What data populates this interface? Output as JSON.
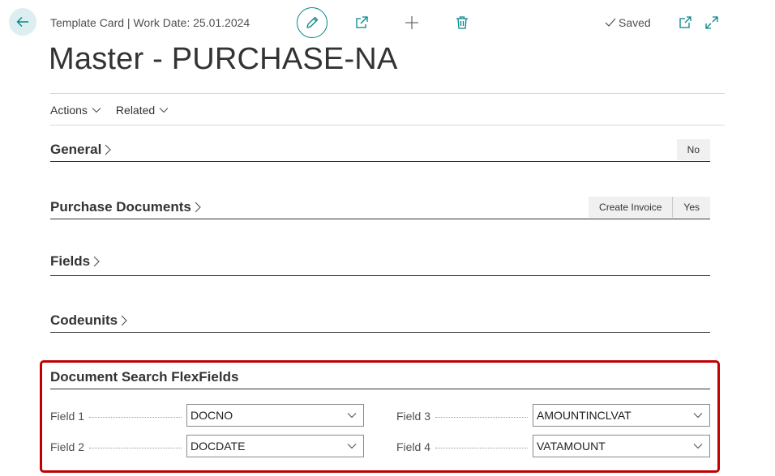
{
  "header": {
    "caption": "Template Card | Work Date: 25.01.2024",
    "saved_label": "Saved"
  },
  "page": {
    "title": "Master - PURCHASE-NA"
  },
  "actions": {
    "actions_label": "Actions",
    "related_label": "Related"
  },
  "sections": {
    "general": {
      "title": "General",
      "pill": "No"
    },
    "purchase_documents": {
      "title": "Purchase Documents",
      "pill_create": "Create Invoice",
      "pill_yes": "Yes"
    },
    "fields": {
      "title": "Fields"
    },
    "codeunits": {
      "title": "Codeunits"
    }
  },
  "flexfields": {
    "title": "Document Search FlexFields",
    "field1": {
      "label": "Field 1",
      "value": "DOCNO"
    },
    "field2": {
      "label": "Field 2",
      "value": "DOCDATE"
    },
    "field3": {
      "label": "Field 3",
      "value": "AMOUNTINCLVAT"
    },
    "field4": {
      "label": "Field 4",
      "value": "VATAMOUNT"
    }
  },
  "colors": {
    "accent": "#00858a",
    "highlight": "#c00000",
    "back_button_bg": "#dbeef0"
  },
  "icons": [
    "back-arrow-icon",
    "pencil-icon",
    "share-icon",
    "plus-icon",
    "trash-icon",
    "checkmark-icon",
    "open-new-window-icon",
    "expand-icon",
    "chevron-down-icon",
    "chevron-right-icon"
  ]
}
